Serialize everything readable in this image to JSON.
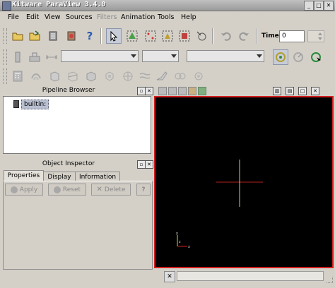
{
  "window": {
    "title": "Kitware ParaView 3.4.0",
    "controls": [
      "_",
      "□",
      "✕"
    ]
  },
  "menu": [
    "File",
    "Edit",
    "View",
    "Sources",
    "Filters",
    "Animation",
    "Tools",
    "Help"
  ],
  "menu_disabled": [
    "Filters"
  ],
  "toolbar": {
    "time_label": "Time:",
    "time_value": "0",
    "help_icon": "?"
  },
  "pipeline_browser": {
    "title": "Pipeline Browser",
    "items": [
      {
        "label": "builtin:"
      }
    ]
  },
  "object_inspector": {
    "title": "Object Inspector",
    "tabs": [
      "Properties",
      "Display",
      "Information"
    ],
    "active_tab": "Properties",
    "buttons": {
      "apply": "Apply",
      "reset": "Reset",
      "delete": "Delete",
      "help": "?"
    }
  },
  "view": {
    "background": "#000000",
    "border_color": "#d02020",
    "axes_labels": [
      "y",
      "x",
      "z"
    ]
  }
}
